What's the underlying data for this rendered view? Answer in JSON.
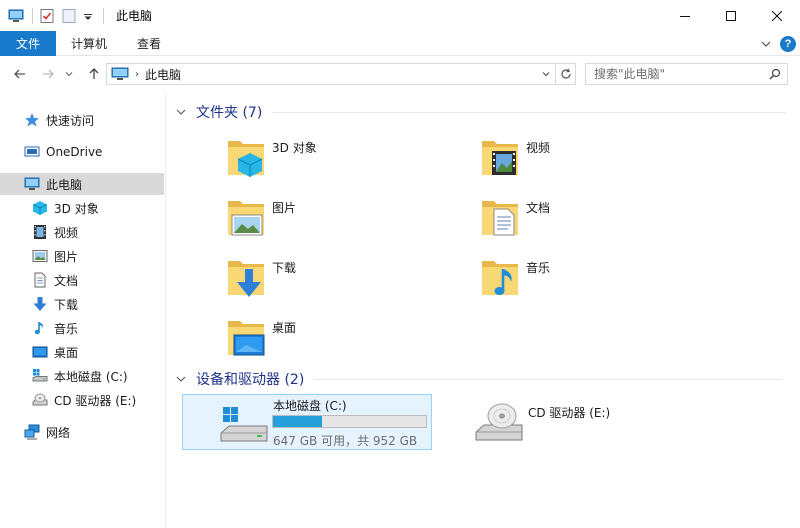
{
  "window": {
    "title": "此电脑"
  },
  "ribbon": {
    "tabs": [
      "文件",
      "计算机",
      "查看"
    ]
  },
  "address": {
    "crumbs": [
      "此电脑"
    ],
    "search_placeholder": "搜索\"此电脑\""
  },
  "nav": {
    "quick_access": "快速访问",
    "onedrive": "OneDrive",
    "this_pc": "此电脑",
    "children": [
      "3D 对象",
      "视频",
      "图片",
      "文档",
      "下载",
      "音乐",
      "桌面",
      "本地磁盘 (C:)",
      "CD 驱动器 (E:)"
    ],
    "network": "网络"
  },
  "folders_group": {
    "header": "文件夹 (7)",
    "items": [
      "3D 对象",
      "视频",
      "图片",
      "文档",
      "下载",
      "音乐",
      "桌面"
    ]
  },
  "drives_group": {
    "header": "设备和驱动器 (2)",
    "local_disk": {
      "name": "本地磁盘 (C:)",
      "usage_fraction": 0.32,
      "detail": "647 GB 可用，共 952 GB"
    },
    "cd_drive": {
      "name": "CD 驱动器 (E:)"
    }
  },
  "colors": {
    "accent": "#1979ca",
    "header_text": "#1e3287",
    "selection": "#d9d9d9",
    "drive_bar": "#26a0da",
    "folder_yellow": "#f8d775"
  }
}
